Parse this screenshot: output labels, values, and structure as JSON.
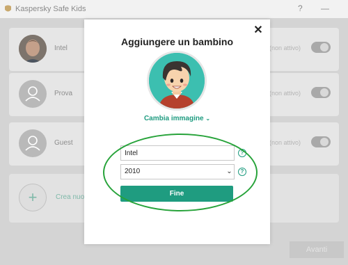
{
  "window": {
    "title": "Kaspersky Safe Kids",
    "help_glyph": "?",
    "minimize_glyph": "—",
    "logo_icon": "kaspersky-logo-icon"
  },
  "children": [
    {
      "name": "Intel",
      "status": "(non attivo)",
      "avatar": "photo"
    },
    {
      "name": "Prova",
      "status": "(non attivo)",
      "avatar": "user-icon"
    },
    {
      "name": "Guest",
      "status": "(non attivo)",
      "avatar": "user-icon"
    }
  ],
  "add_child": {
    "plus_glyph": "+",
    "label": "Crea nuovo"
  },
  "footer": {
    "button_label": "Avanti"
  },
  "modal": {
    "title": "Aggiungere un bambino",
    "close_glyph": "✕",
    "change_image_label": "Cambia immagine",
    "change_image_chevron": "⌄",
    "name_value": "Intel",
    "year_value": "2010",
    "year_chevron": "⌄",
    "help_glyph": "?",
    "finish_label": "Fine"
  },
  "colors": {
    "accent": "#1f9c80",
    "annotation": "#27a33a",
    "avatar_bg": "#3cbfb0"
  }
}
